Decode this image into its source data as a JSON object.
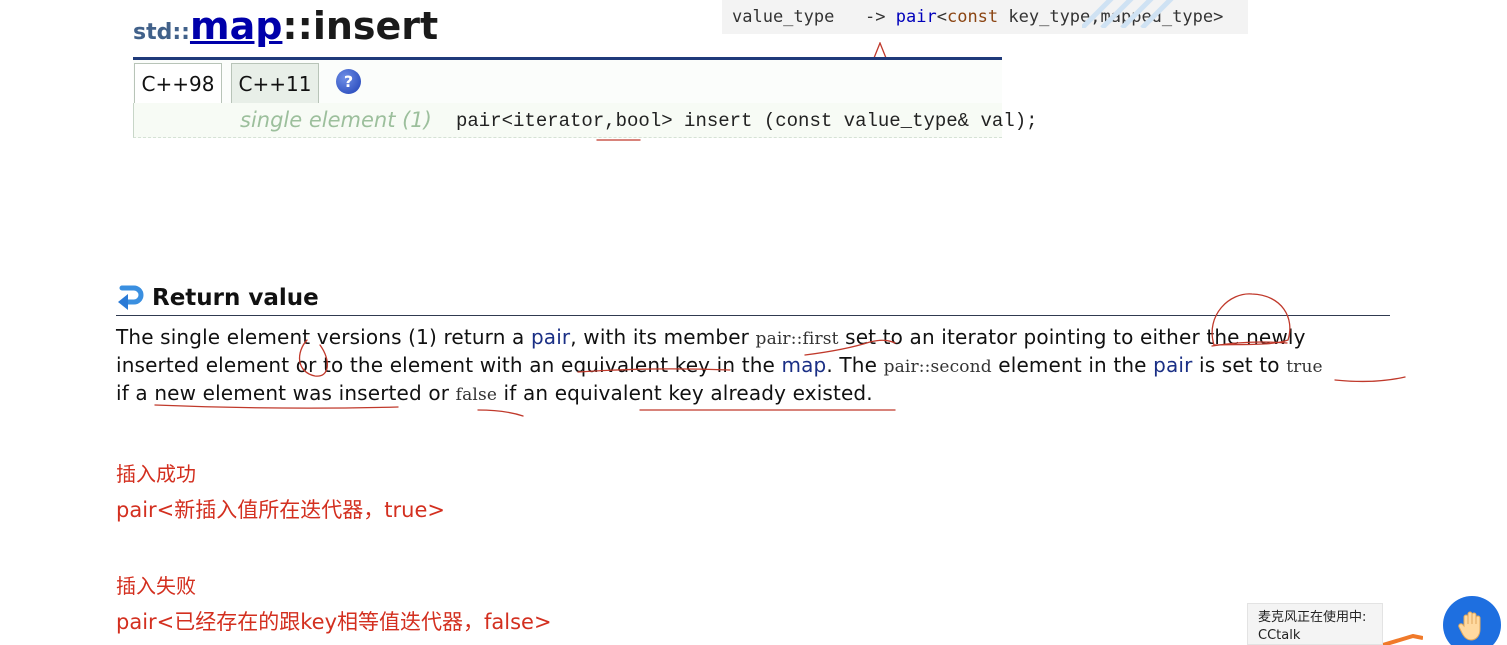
{
  "header": {
    "namespace": "std::",
    "class_name": "map",
    "function_name": "::insert"
  },
  "code_box": {
    "left": "value_type   -> ",
    "pair": "pair",
    "open": "<",
    "const_kw": "const",
    "rest": " key_type,mapped_type>"
  },
  "tabs": [
    {
      "label": "C++98",
      "active": true
    },
    {
      "label": "C++11",
      "active": false
    }
  ],
  "help_icon": {
    "glyph": "?"
  },
  "signature": {
    "label": "single element (1)",
    "code": "pair<iterator,bool> insert (const value_type& val);"
  },
  "return_section": {
    "title": "Return value",
    "paragraph": {
      "l1": {
        "a": "The single element versions (1) return a ",
        "pair": "pair",
        "b": ", with its member ",
        "code": "pair::first",
        "c": " set to an iterator pointing to either the newly"
      },
      "l2": {
        "a": "inserted element or to the element with an equivalent key in the ",
        "map": "map",
        "b": ". The ",
        "code": "pair::second",
        "c": " element in the ",
        "pair": "pair",
        "d": " is set to ",
        "true": "true"
      },
      "l3": {
        "a": "if a new element was inserted or ",
        "false": "false",
        "b": " if an equivalent key already existed."
      }
    }
  },
  "notes": {
    "success_heading": "插入成功",
    "success_body": "pair<新插入值所在迭代器，true>",
    "fail_heading": "插入失败",
    "fail_body": "pair<已经存在的跟key相等值迭代器，false>"
  },
  "mic_toast": {
    "line1": "麦克风正在使用中:",
    "line2": "CCtalk"
  },
  "colors": {
    "link_blue": "#1a2f85",
    "annotation_red": "#d32f1f",
    "title_blue": "#0000aa",
    "tab_bar_border": "#1f3a7a"
  },
  "icons": [
    "return-arrow-icon",
    "help-icon",
    "hand-icon",
    "up-arrow-annotation"
  ]
}
